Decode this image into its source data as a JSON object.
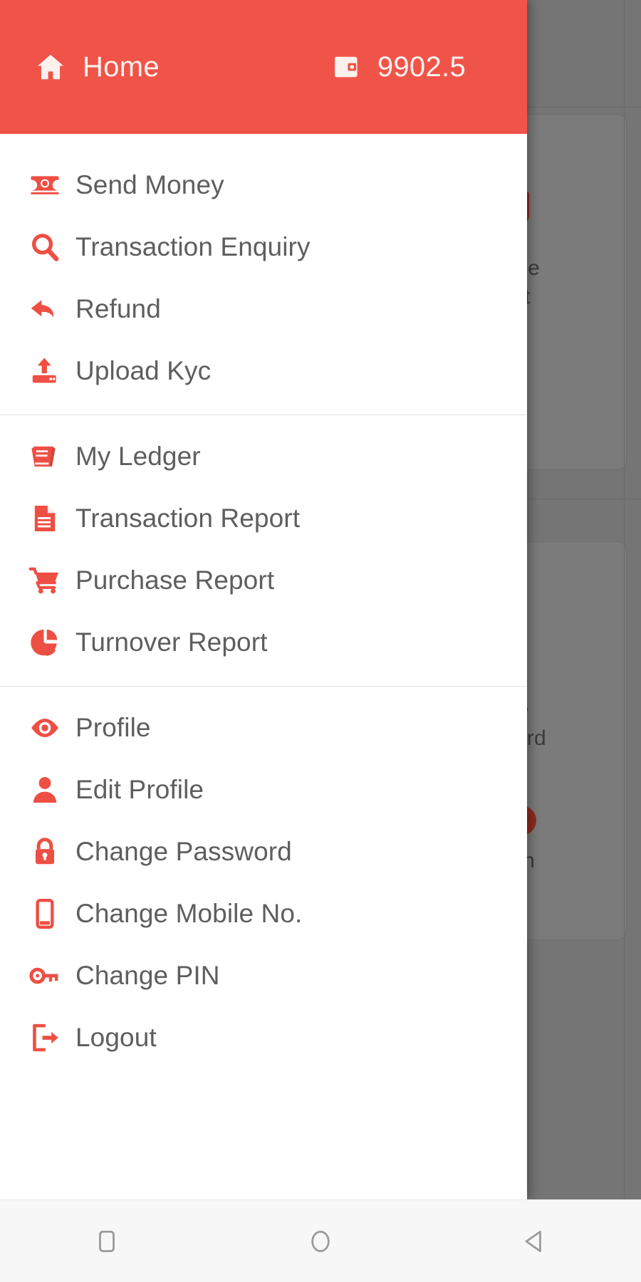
{
  "theme": {
    "accent": "#f05449",
    "accent_icon": "#ee4f44",
    "header_text": "#fdf1ee",
    "menu_text": "#5e5e5e",
    "drawer_bg": "#ffffff",
    "scrim": "#757575",
    "divider": "#e2e2e2",
    "navbar_bg": "#f7f7f7",
    "navbar_icon": "#9a9a9a"
  },
  "header": {
    "home_icon": "home-icon",
    "title": "Home",
    "wallet_icon": "wallet-icon",
    "balance": "9902.5"
  },
  "menu": {
    "groups": [
      {
        "items": [
          {
            "label": "Send Money",
            "icon": "banknote-icon"
          },
          {
            "label": "Transaction Enquiry",
            "icon": "search-icon"
          },
          {
            "label": "Refund",
            "icon": "reply-arrow-icon"
          },
          {
            "label": "Upload Kyc",
            "icon": "upload-icon"
          }
        ]
      },
      {
        "items": [
          {
            "label": "My Ledger",
            "icon": "book-icon"
          },
          {
            "label": "Transaction Report",
            "icon": "document-icon"
          },
          {
            "label": "Purchase Report",
            "icon": "shopping-cart-icon"
          },
          {
            "label": "Turnover Report",
            "icon": "pie-chart-icon"
          }
        ]
      },
      {
        "items": [
          {
            "label": "Profile",
            "icon": "eye-icon"
          },
          {
            "label": "Edit Profile",
            "icon": "person-icon"
          },
          {
            "label": "Change Password",
            "icon": "lock-icon"
          },
          {
            "label": "Change Mobile No.",
            "icon": "mobile-phone-icon"
          },
          {
            "label": "Change PIN",
            "icon": "key-icon"
          },
          {
            "label": "Logout",
            "icon": "sign-out-icon"
          }
        ]
      }
    ]
  },
  "background": {
    "visible_card_labels": [
      "ase",
      "ort",
      "ge",
      "word",
      "Pin"
    ]
  },
  "navbar": {
    "buttons": [
      {
        "name": "recents-button",
        "icon": "square-icon"
      },
      {
        "name": "home-button",
        "icon": "circle-icon"
      },
      {
        "name": "back-button",
        "icon": "triangle-left-icon"
      }
    ]
  }
}
